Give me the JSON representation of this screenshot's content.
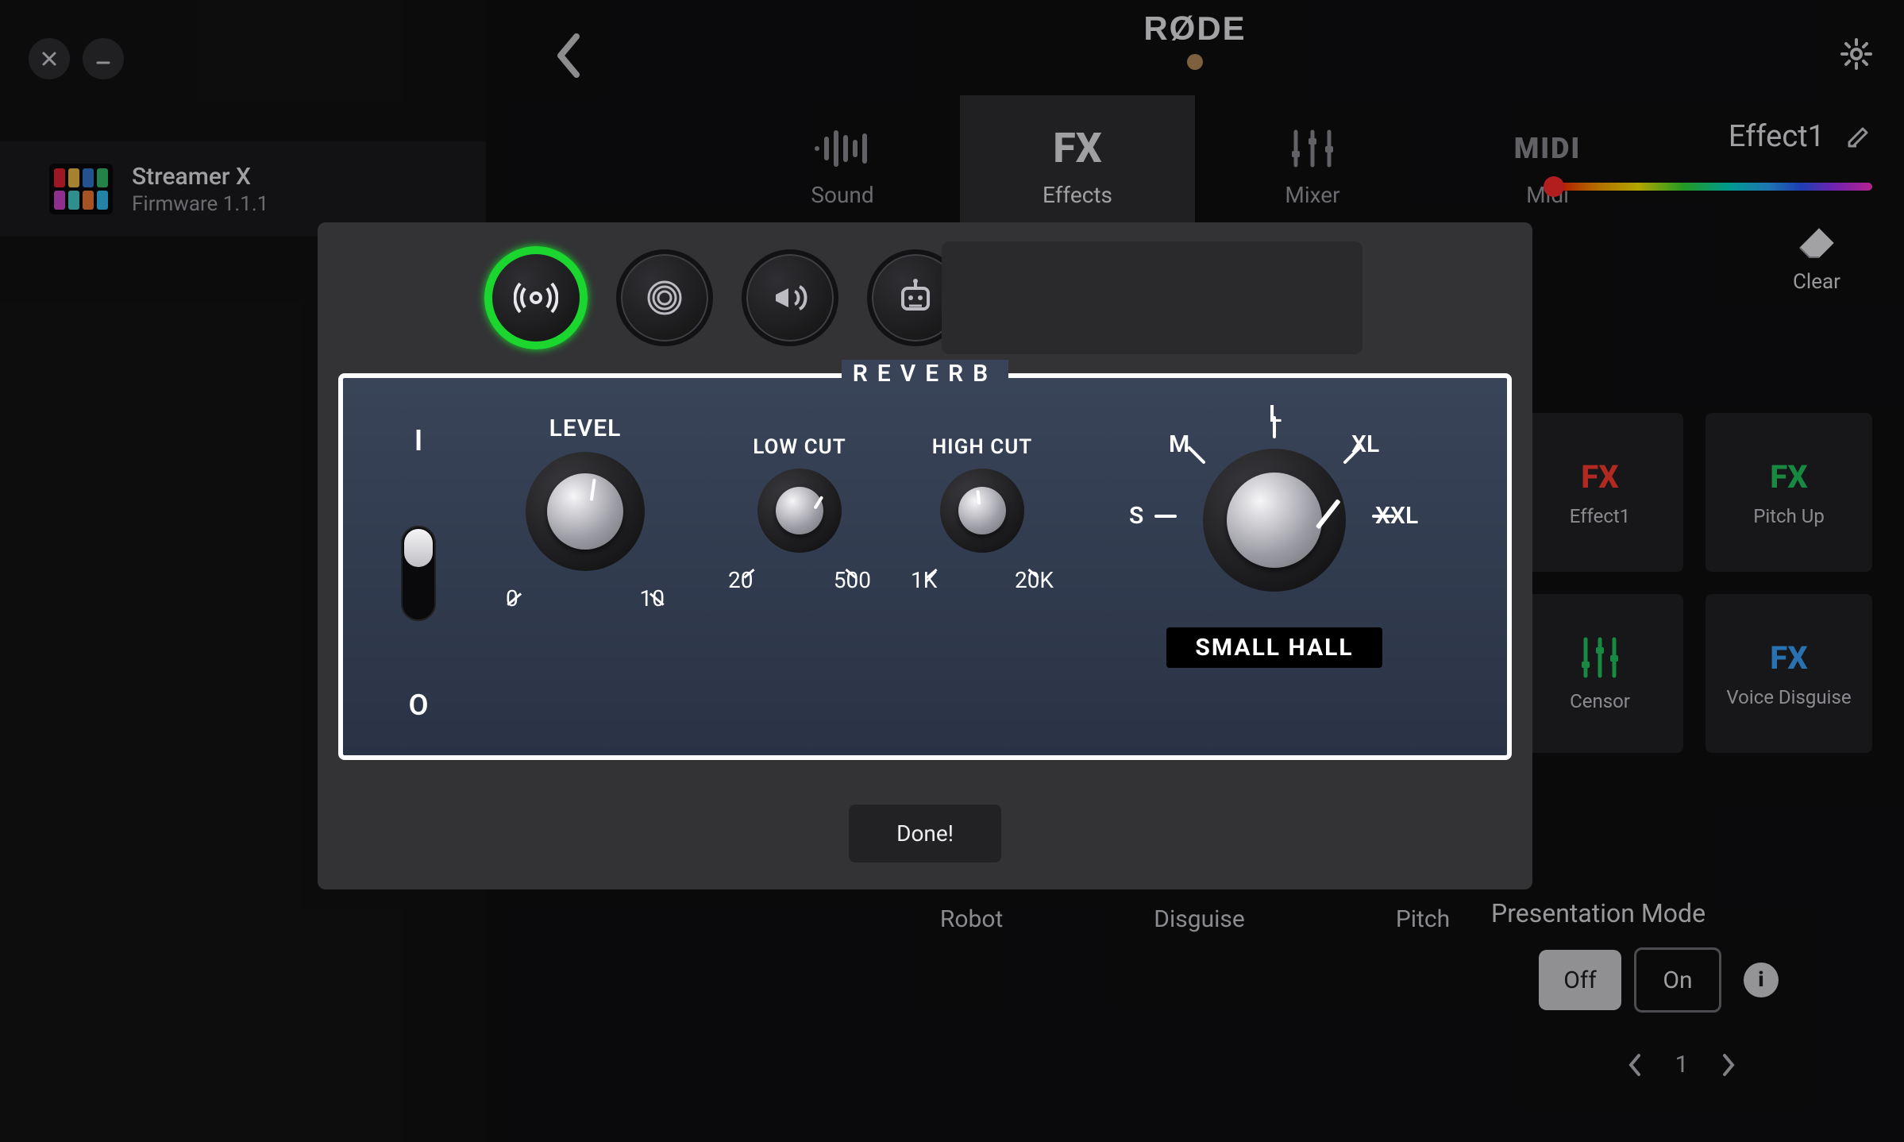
{
  "device": {
    "name": "Streamer X",
    "firmware": "Firmware 1.1.1"
  },
  "header": {
    "logo": "RØDE"
  },
  "tabs": [
    {
      "id": "sound",
      "label": "Sound"
    },
    {
      "id": "effects",
      "label": "Effects",
      "big": "FX"
    },
    {
      "id": "mixer",
      "label": "Mixer"
    },
    {
      "id": "midi",
      "label": "Midi",
      "big": "MIDI"
    }
  ],
  "behind_labels": [
    "Robot",
    "Disguise",
    "Pitch"
  ],
  "effect": {
    "name": "Effect1"
  },
  "clear_label": "Clear",
  "presets": [
    {
      "label": "Effect1",
      "fx_color": "#ff3b30",
      "big": "FX"
    },
    {
      "label": "Pitch Up",
      "fx_color": "#22c55e",
      "big": "FX"
    },
    {
      "label": "Censor",
      "fx_color": "#22c55e",
      "big": "",
      "sliders": true
    },
    {
      "label": "Voice Disguise",
      "fx_color": "#3aa4ff",
      "big": "FX"
    }
  ],
  "presentation": {
    "title": "Presentation Mode",
    "off": "Off",
    "on": "On",
    "page": "1"
  },
  "modal": {
    "title": "REVERB",
    "io": {
      "top": "I",
      "bottom": "O"
    },
    "level": {
      "label": "LEVEL",
      "min": "0",
      "max": "10"
    },
    "lowcut": {
      "label": "LOW CUT",
      "min": "20",
      "max": "500"
    },
    "highcut": {
      "label": "HIGH CUT",
      "min": "1K",
      "max": "20K"
    },
    "size_labels": {
      "S": "S",
      "M": "M",
      "L": "L",
      "XL": "XL",
      "XXL": "XXL"
    },
    "size_name": "SMALL HALL",
    "done": "Done!"
  }
}
